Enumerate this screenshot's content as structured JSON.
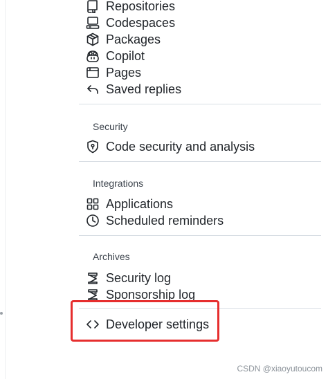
{
  "account_menu": {
    "items": [
      {
        "label": "Repositories",
        "icon": "repo-icon"
      },
      {
        "label": "Codespaces",
        "icon": "codespaces-icon"
      },
      {
        "label": "Packages",
        "icon": "package-icon"
      },
      {
        "label": "Copilot",
        "icon": "copilot-icon"
      },
      {
        "label": "Pages",
        "icon": "browser-icon"
      },
      {
        "label": "Saved replies",
        "icon": "reply-icon"
      }
    ]
  },
  "security": {
    "heading": "Security",
    "items": [
      {
        "label": "Code security and analysis",
        "icon": "shield-lock-icon"
      }
    ]
  },
  "integrations": {
    "heading": "Integrations",
    "items": [
      {
        "label": "Applications",
        "icon": "apps-icon"
      },
      {
        "label": "Scheduled reminders",
        "icon": "clock-icon"
      }
    ]
  },
  "archives": {
    "heading": "Archives",
    "items": [
      {
        "label": "Security log",
        "icon": "log-icon"
      },
      {
        "label": "Sponsorship log",
        "icon": "log-icon"
      }
    ]
  },
  "developer": {
    "label": "Developer settings",
    "icon": "code-icon",
    "highlight_color": "#e62e2e"
  },
  "watermark": "CSDN @xiaoyutoucom"
}
